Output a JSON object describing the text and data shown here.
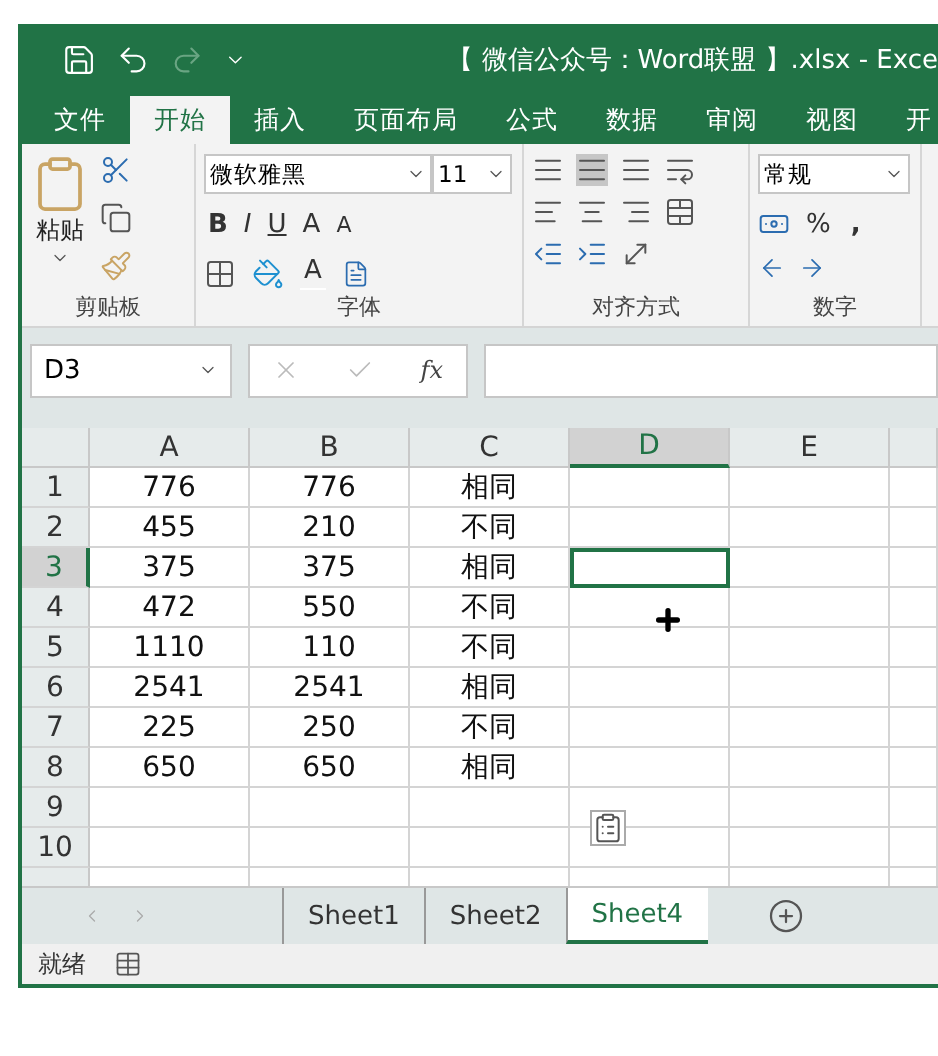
{
  "title_bar": {
    "title": "【 微信公众号：Word联盟 】.xlsx - Exce"
  },
  "menu_tabs": [
    {
      "label": "文件",
      "selected": false
    },
    {
      "label": "开始",
      "selected": true
    },
    {
      "label": "插入",
      "selected": false
    },
    {
      "label": "页面布局",
      "selected": false
    },
    {
      "label": "公式",
      "selected": false
    },
    {
      "label": "数据",
      "selected": false
    },
    {
      "label": "审阅",
      "selected": false
    },
    {
      "label": "视图",
      "selected": false
    },
    {
      "label": "开",
      "selected": false
    }
  ],
  "ribbon": {
    "paste_label": "粘贴",
    "font_name": "微软雅黑",
    "font_size": "11",
    "bold": "B",
    "italic": "I",
    "underline": "U",
    "grow_font": "A",
    "shrink_font": "A",
    "font_color": "A",
    "number_format": "常规",
    "percent": "%",
    "comma": ",",
    "groups": [
      "剪贴板",
      "字体",
      "对齐方式",
      "数字"
    ]
  },
  "formula_bar": {
    "name_box": "D3",
    "function_label": "fx"
  },
  "columns": [
    {
      "label": "A",
      "selected": false
    },
    {
      "label": "B",
      "selected": false
    },
    {
      "label": "C",
      "selected": false
    },
    {
      "label": "D",
      "selected": true
    },
    {
      "label": "E",
      "selected": false
    }
  ],
  "rows": [
    {
      "label": "1",
      "selected": false,
      "cells": [
        "776",
        "776",
        "相同"
      ]
    },
    {
      "label": "2",
      "selected": false,
      "cells": [
        "455",
        "210",
        "不同"
      ]
    },
    {
      "label": "3",
      "selected": true,
      "cells": [
        "375",
        "375",
        "相同"
      ]
    },
    {
      "label": "4",
      "selected": false,
      "cells": [
        "472",
        "550",
        "不同"
      ]
    },
    {
      "label": "5",
      "selected": false,
      "cells": [
        "1110",
        "110",
        "不同"
      ]
    },
    {
      "label": "6",
      "selected": false,
      "cells": [
        "2541",
        "2541",
        "相同"
      ]
    },
    {
      "label": "7",
      "selected": false,
      "cells": [
        "225",
        "250",
        "不同"
      ]
    },
    {
      "label": "8",
      "selected": false,
      "cells": [
        "650",
        "650",
        "相同"
      ]
    },
    {
      "label": "9",
      "selected": false,
      "cells": []
    },
    {
      "label": "10",
      "selected": false,
      "cells": []
    }
  ],
  "sheets": [
    {
      "label": "Sheet1",
      "selected": false
    },
    {
      "label": "Sheet2",
      "selected": false
    },
    {
      "label": "Sheet4",
      "selected": true
    }
  ],
  "status_bar": {
    "status": "就绪"
  }
}
